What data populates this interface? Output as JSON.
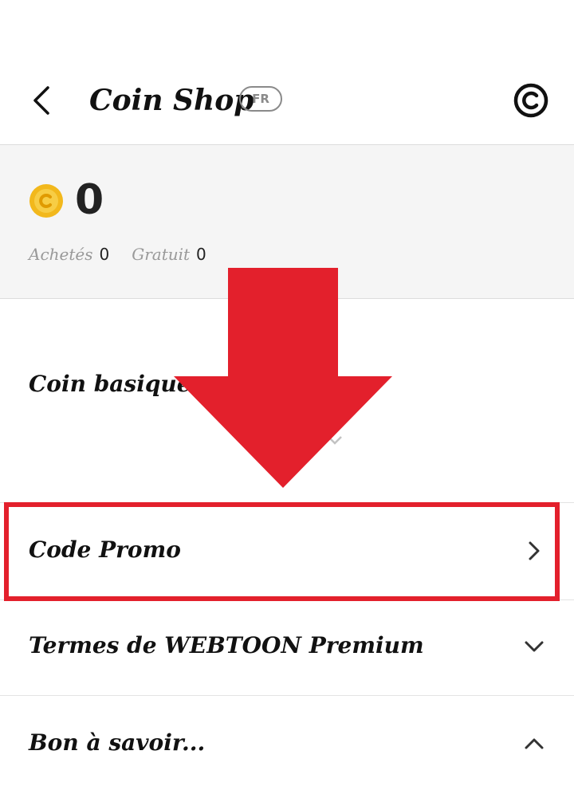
{
  "header": {
    "title": "Coin Shop",
    "language_badge": "FR"
  },
  "balance": {
    "total": "0",
    "purchased_label": "Achetés",
    "purchased_value": "0",
    "free_label": "Gratuit",
    "free_value": "0"
  },
  "sections": {
    "basic_coin": "Coin basique",
    "promo_code": "Code Promo",
    "premium_terms": "Termes de WEBTOON Premium",
    "good_to_know": "Bon à savoir..."
  },
  "colors": {
    "annotation_red": "#e3202c",
    "coin_gold": "#f2b81c"
  },
  "icons": [
    "back-arrow-icon",
    "copyright-icon",
    "coin-icon",
    "chevron-right-icon",
    "chevron-down-icon",
    "chevron-up-icon",
    "down-arrow-annotation"
  ]
}
